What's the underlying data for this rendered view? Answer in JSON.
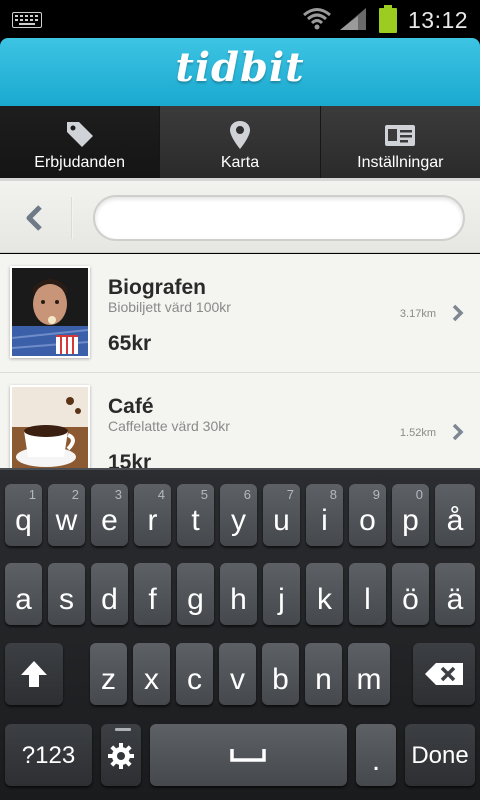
{
  "status_bar": {
    "time": "13:12",
    "icons": [
      "keyboard-icon",
      "wifi-icon",
      "signal-icon",
      "battery-icon"
    ],
    "battery_color": "#9ccc1f"
  },
  "app": {
    "logo_text": "tidbit",
    "header_color": "#2bb6da"
  },
  "tabs": [
    {
      "label": "Erbjudanden",
      "icon": "tag-icon",
      "active": true
    },
    {
      "label": "Karta",
      "icon": "map-pin-icon",
      "active": false
    },
    {
      "label": "Inställningar",
      "icon": "id-card-icon",
      "active": false
    }
  ],
  "search": {
    "value": "",
    "placeholder": ""
  },
  "offers": [
    {
      "title": "Biografen",
      "subtitle": "Biobiljett värd 100kr",
      "price": "65kr",
      "distance": "3.17km",
      "image": "cinema-person-photo"
    },
    {
      "title": "Café",
      "subtitle": "Caffelatte värd 30kr",
      "price": "15kr",
      "distance": "1.52km",
      "image": "coffee-cup-photo"
    }
  ],
  "keyboard": {
    "row1": [
      {
        "key": "q",
        "num": "1"
      },
      {
        "key": "w",
        "num": "2"
      },
      {
        "key": "e",
        "num": "3"
      },
      {
        "key": "r",
        "num": "4"
      },
      {
        "key": "t",
        "num": "5"
      },
      {
        "key": "y",
        "num": "6"
      },
      {
        "key": "u",
        "num": "7"
      },
      {
        "key": "i",
        "num": "8"
      },
      {
        "key": "o",
        "num": "9"
      },
      {
        "key": "p",
        "num": "0"
      },
      {
        "key": "å",
        "num": ""
      }
    ],
    "row2": [
      "a",
      "s",
      "d",
      "f",
      "g",
      "h",
      "j",
      "k",
      "l",
      "ö",
      "ä"
    ],
    "row3": [
      "z",
      "x",
      "c",
      "v",
      "b",
      "n",
      "m"
    ],
    "symbols_label": "?123",
    "done_label": "Done",
    "period_label": "."
  }
}
